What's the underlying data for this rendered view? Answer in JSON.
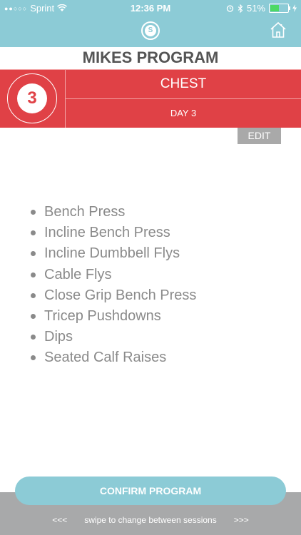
{
  "status_bar": {
    "carrier": "Sprint",
    "time": "12:36 PM",
    "battery": "51%"
  },
  "nav": {
    "logo_letter": "S"
  },
  "program": {
    "title": "MIKES PROGRAM",
    "day_number": "3",
    "workout_name": "CHEST",
    "day_label": "DAY 3",
    "edit_label": "EDIT"
  },
  "exercises": [
    "Bench Press",
    "Incline Bench Press",
    "Incline Dumbbell Flys",
    "Cable Flys",
    "Close Grip Bench Press",
    "Tricep Pushdowns",
    "Dips",
    "Seated Calf Raises"
  ],
  "footer": {
    "confirm_label": "CONFIRM PROGRAM",
    "swipe_left": "<<<",
    "swipe_text": "swipe to change between sessions",
    "swipe_right": ">>>"
  },
  "colors": {
    "accent": "#8ccbd6",
    "header_red": "#e04146",
    "text_gray": "#8a8a8a"
  }
}
